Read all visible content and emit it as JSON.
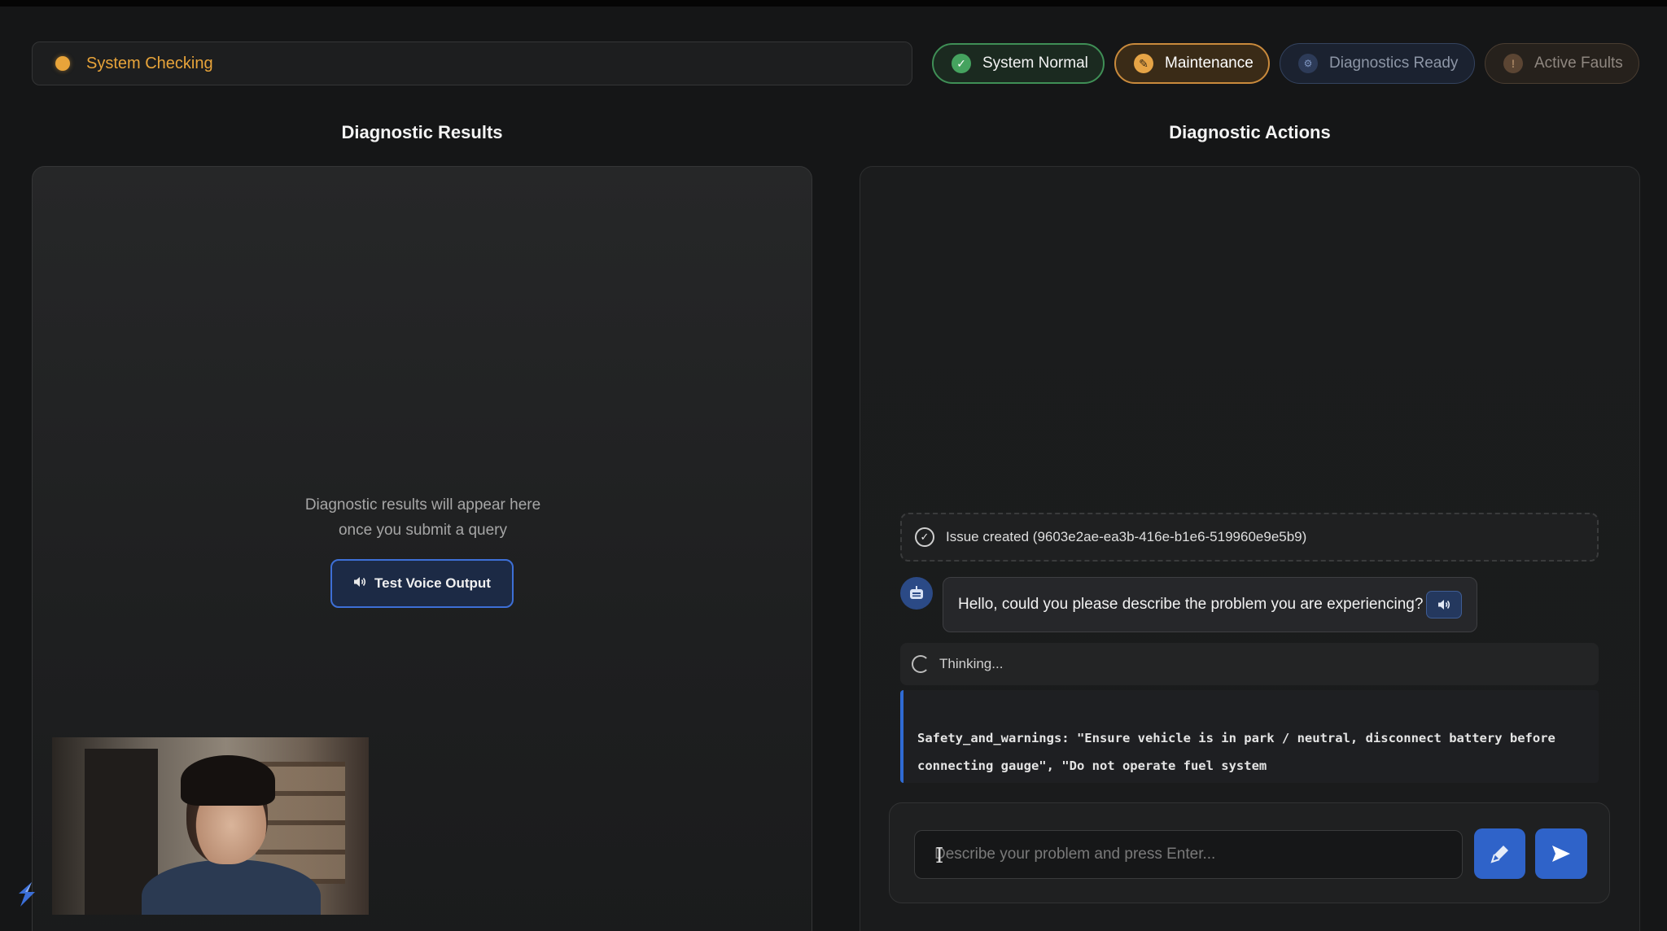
{
  "status_bar": {
    "text": "System Checking",
    "color": "#e8a43a"
  },
  "pills": {
    "normal": {
      "label": "System Normal",
      "icon": "check-icon",
      "glyph": "✓"
    },
    "maintenance": {
      "label": "Maintenance",
      "icon": "wrench-icon",
      "glyph": "✎"
    },
    "diagnostics": {
      "label": "Diagnostics Ready",
      "icon": "gear-icon",
      "glyph": "⚙"
    },
    "faults": {
      "label": "Active Faults",
      "icon": "alert-icon",
      "glyph": "!"
    }
  },
  "left_panel": {
    "title": "Diagnostic Results",
    "placeholder_line1": "Diagnostic results will appear here",
    "placeholder_line2": "once you submit a query",
    "test_voice_label": "Test Voice Output"
  },
  "right_panel": {
    "title": "Diagnostic Actions",
    "issue_text": "Issue created (9603e2ae-ea3b-416e-b1e6-519960e9e5b9)",
    "bot_message": "Hello, could you please describe the problem you are experiencing?",
    "thinking_text": "Thinking...",
    "code_line1": "Safety_and_warnings: \"Ensure vehicle is in park / neutral, disconnect battery before",
    "code_line2": "connecting gauge\", \"Do not operate fuel system",
    "input_placeholder": "Describe your problem and press Enter..."
  },
  "colors": {
    "accent": "#2f63c9",
    "success": "#45a35f",
    "warning": "#e6a446"
  }
}
